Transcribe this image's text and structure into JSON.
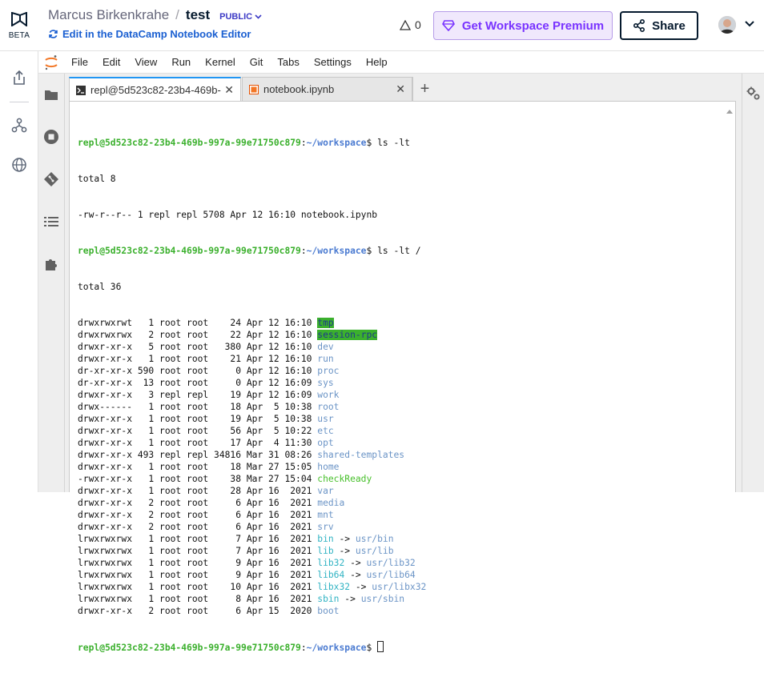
{
  "header": {
    "beta_label": "BETA",
    "owner": "Marcus Birkenkrahe",
    "separator": "/",
    "project": "test",
    "visibility": "PUBLIC",
    "edit_link": "Edit in the DataCamp Notebook Editor",
    "alert_count": "0",
    "premium_label": "Get Workspace Premium",
    "share_label": "Share"
  },
  "jupyter": {
    "menu": [
      "File",
      "Edit",
      "View",
      "Run",
      "Kernel",
      "Git",
      "Tabs",
      "Settings",
      "Help"
    ],
    "tabs": [
      {
        "label": "repl@5d523c82-23b4-469b-",
        "close": "✕"
      },
      {
        "label": "notebook.ipynb",
        "close": "✕"
      }
    ],
    "add_tab": "+"
  },
  "terminal": {
    "prompt_user": "repl@5d523c82-23b4-469b-997a-99e71750c879",
    "prompt_path": "~/workspace",
    "cmd1": "ls -lt",
    "total1": "total 8",
    "file1": "-rw-r--r-- 1 repl repl 5708 Apr 12 16:10 notebook.ipynb",
    "cmd2": "ls -lt /",
    "total2": "total 36",
    "entries": [
      {
        "meta": "drwxrwxrwt   1 root root    24 Apr 12 16:10 ",
        "name": "tmp",
        "kind": "sticky"
      },
      {
        "meta": "drwxrwxrwx   2 root root    22 Apr 12 16:10 ",
        "name": "session-rpc",
        "kind": "sticky"
      },
      {
        "meta": "drwxr-xr-x   5 root root   380 Apr 12 16:10 ",
        "name": "dev",
        "kind": "dir"
      },
      {
        "meta": "drwxr-xr-x   1 root root    21 Apr 12 16:10 ",
        "name": "run",
        "kind": "dir"
      },
      {
        "meta": "dr-xr-xr-x 590 root root     0 Apr 12 16:10 ",
        "name": "proc",
        "kind": "dir"
      },
      {
        "meta": "dr-xr-xr-x  13 root root     0 Apr 12 16:09 ",
        "name": "sys",
        "kind": "dir"
      },
      {
        "meta": "drwxr-xr-x   3 repl repl    19 Apr 12 16:09 ",
        "name": "work",
        "kind": "dir"
      },
      {
        "meta": "drwx------   1 root root    18 Apr  5 10:38 ",
        "name": "root",
        "kind": "dir"
      },
      {
        "meta": "drwxr-xr-x   1 root root    19 Apr  5 10:38 ",
        "name": "usr",
        "kind": "dir"
      },
      {
        "meta": "drwxr-xr-x   1 root root    56 Apr  5 10:22 ",
        "name": "etc",
        "kind": "dir"
      },
      {
        "meta": "drwxr-xr-x   1 root root    17 Apr  4 11:30 ",
        "name": "opt",
        "kind": "dir"
      },
      {
        "meta": "drwxr-xr-x 493 repl repl 34816 Mar 31 08:26 ",
        "name": "shared-templates",
        "kind": "dir"
      },
      {
        "meta": "drwxr-xr-x   1 root root    18 Mar 27 15:05 ",
        "name": "home",
        "kind": "dir"
      },
      {
        "meta": "-rwxr-xr-x   1 root root    38 Mar 27 15:04 ",
        "name": "checkReady",
        "kind": "exe"
      },
      {
        "meta": "drwxr-xr-x   1 root root    28 Apr 16  2021 ",
        "name": "var",
        "kind": "dir"
      },
      {
        "meta": "drwxr-xr-x   2 root root     6 Apr 16  2021 ",
        "name": "media",
        "kind": "dir"
      },
      {
        "meta": "drwxr-xr-x   2 root root     6 Apr 16  2021 ",
        "name": "mnt",
        "kind": "dir"
      },
      {
        "meta": "drwxr-xr-x   2 root root     6 Apr 16  2021 ",
        "name": "srv",
        "kind": "dir"
      },
      {
        "meta": "lrwxrwxrwx   1 root root     7 Apr 16  2021 ",
        "name": "bin",
        "kind": "lnk",
        "target": "usr/bin"
      },
      {
        "meta": "lrwxrwxrwx   1 root root     7 Apr 16  2021 ",
        "name": "lib",
        "kind": "lnk",
        "target": "usr/lib"
      },
      {
        "meta": "lrwxrwxrwx   1 root root     9 Apr 16  2021 ",
        "name": "lib32",
        "kind": "lnk",
        "target": "usr/lib32"
      },
      {
        "meta": "lrwxrwxrwx   1 root root     9 Apr 16  2021 ",
        "name": "lib64",
        "kind": "lnk",
        "target": "usr/lib64"
      },
      {
        "meta": "lrwxrwxrwx   1 root root    10 Apr 16  2021 ",
        "name": "libx32",
        "kind": "lnk",
        "target": "usr/libx32"
      },
      {
        "meta": "lrwxrwxrwx   1 root root     8 Apr 16  2021 ",
        "name": "sbin",
        "kind": "lnk",
        "target": "usr/sbin"
      },
      {
        "meta": "drwxr-xr-x   2 root root     6 Apr 15  2020 ",
        "name": "boot",
        "kind": "dir"
      }
    ],
    "arrow": " -> "
  },
  "colors": {
    "accent": "#3c3ac6",
    "premium": "#7933ff",
    "prompt_user": "#3bb02d",
    "prompt_path": "#4b7bd1",
    "dir": "#6b94c6",
    "exe": "#48c02c",
    "link": "#30b3c3",
    "sticky_bg": "#3bb02d"
  },
  "icons": {
    "rail": [
      "upload-icon",
      "share-network-icon",
      "globe-icon"
    ],
    "jupyter_sidebar": [
      "folder-icon",
      "stop-circle-icon",
      "git-icon",
      "list-icon",
      "extension-icon"
    ],
    "right_sidebar": [
      "property-inspector-icon"
    ]
  }
}
